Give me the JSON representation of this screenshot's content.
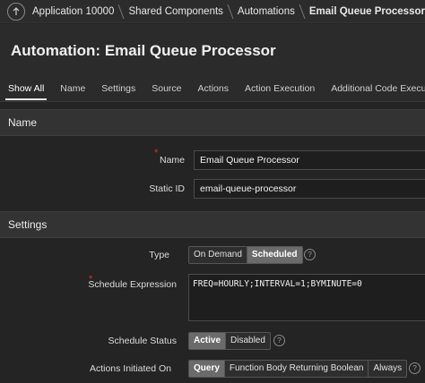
{
  "breadcrumb": {
    "items": [
      "Application 10000",
      "Shared Components",
      "Automations",
      "Email Queue Processor"
    ]
  },
  "page": {
    "title": "Automation: Email Queue Processor"
  },
  "tabs": [
    "Show All",
    "Name",
    "Settings",
    "Source",
    "Actions",
    "Action Execution",
    "Additional Code Execution"
  ],
  "sections": {
    "name": {
      "heading": "Name",
      "name_label": "Name",
      "name_value": "Email Queue Processor",
      "static_id_label": "Static ID",
      "static_id_value": "email-queue-processor"
    },
    "settings": {
      "heading": "Settings",
      "type_label": "Type",
      "type_options": [
        "On Demand",
        "Scheduled"
      ],
      "type_selected": "Scheduled",
      "schedule_expression_label": "Schedule Expression",
      "schedule_expression_value": "FREQ=HOURLY;INTERVAL=1;BYMINUTE=0",
      "schedule_status_label": "Schedule Status",
      "status_options": [
        "Active",
        "Disabled"
      ],
      "status_selected": "Active",
      "actions_initiated_label": "Actions Initiated On",
      "actions_options": [
        "Query",
        "Function Body Returning Boolean",
        "Always"
      ],
      "actions_selected": "Query"
    }
  },
  "help_glyph": "?",
  "required_glyph": "*",
  "colors": {
    "background": "#242424",
    "selected_segment": "#6b6b6b",
    "required": "#dd3333"
  }
}
